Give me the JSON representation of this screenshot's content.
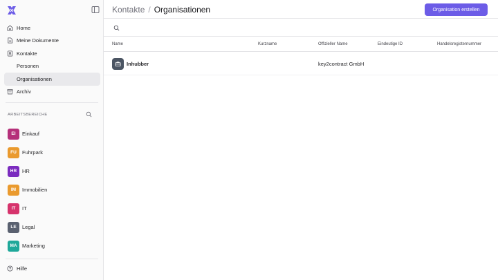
{
  "sidebar": {
    "nav": [
      {
        "label": "Home",
        "icon": "home-icon"
      },
      {
        "label": "Meine Dokumente",
        "icon": "document-icon"
      },
      {
        "label": "Kontakte",
        "icon": "contacts-icon"
      },
      {
        "label": "Personen"
      },
      {
        "label": "Organisationen",
        "active": true
      },
      {
        "label": "Archiv",
        "icon": "archive-icon"
      }
    ],
    "workspaces_title": "ARBEITSBEREICHE",
    "workspaces": [
      {
        "abbr": "EI",
        "label": "Einkauf",
        "color": "#b5307a"
      },
      {
        "abbr": "FU",
        "label": "Fuhrpark",
        "color": "#ea9a2e"
      },
      {
        "abbr": "HR",
        "label": "HR",
        "color": "#7b2cbf"
      },
      {
        "abbr": "IM",
        "label": "Immobilien",
        "color": "#ea9a2e"
      },
      {
        "abbr": "IT",
        "label": "IT",
        "color": "#d6336c"
      },
      {
        "abbr": "LE",
        "label": "Legal",
        "color": "#5a6170"
      },
      {
        "abbr": "MA",
        "label": "Marketing",
        "color": "#1fa89a"
      }
    ],
    "help_label": "Hilfe"
  },
  "header": {
    "breadcrumb_parent": "Kontakte",
    "breadcrumb_sep": "/",
    "breadcrumb_current": "Organisationen",
    "create_button": "Organisation erstellen"
  },
  "search": {
    "placeholder": ""
  },
  "table": {
    "columns": [
      "Name",
      "Kurzname",
      "Offizieller Name",
      "Eindeutige ID",
      "Handelsregisternummer"
    ],
    "rows": [
      {
        "name": "Inhubber",
        "short_name": "",
        "official_name": "key2contract GmbH",
        "unique_id": "",
        "register_number": ""
      }
    ]
  },
  "colors": {
    "accent": "#6c5ce7"
  }
}
